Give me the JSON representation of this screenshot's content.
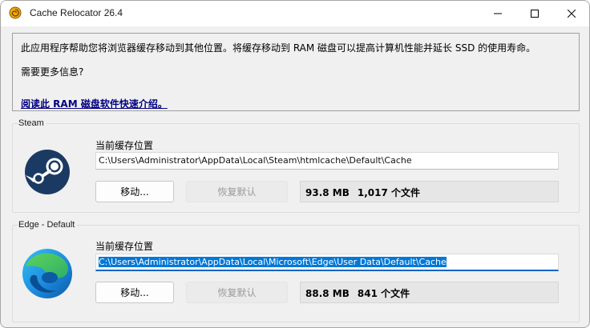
{
  "window": {
    "title": "Cache Relocator 26.4"
  },
  "info": {
    "line1": "此应用程序帮助您将浏览器缓存移动到其他位置。将缓存移动到 RAM 磁盘可以提高计算机性能并延长 SSD 的使用寿命。",
    "line2": "需要更多信息?",
    "link": "阅读此 RAM 磁盘软件快速介绍。"
  },
  "steam": {
    "group_title": "Steam",
    "field_label": "当前缓存位置",
    "path": "C:\\Users\\Administrator\\AppData\\Local\\Steam\\htmlcache\\Default\\Cache",
    "move_label": "移动...",
    "restore_label": "恢复默认",
    "size": "93.8 MB",
    "files": "1,017 个文件"
  },
  "edge": {
    "group_title": "Edge - Default",
    "field_label": "当前缓存位置",
    "path": "C:\\Users\\Administrator\\AppData\\Local\\Microsoft\\Edge\\User Data\\Default\\Cache",
    "move_label": "移动...",
    "restore_label": "恢复默认",
    "size": "88.8 MB",
    "files": "841 个文件"
  },
  "colors": {
    "link": "#000080",
    "selection": "#0078d7",
    "focus_underline": "#0a64c8",
    "steam_logo": "#1b3a63"
  },
  "icons": {
    "app": "snail-icon",
    "minimize": "minimize-icon",
    "maximize": "maximize-icon",
    "close": "close-icon",
    "steam": "steam-logo-icon",
    "edge": "edge-logo-icon"
  }
}
